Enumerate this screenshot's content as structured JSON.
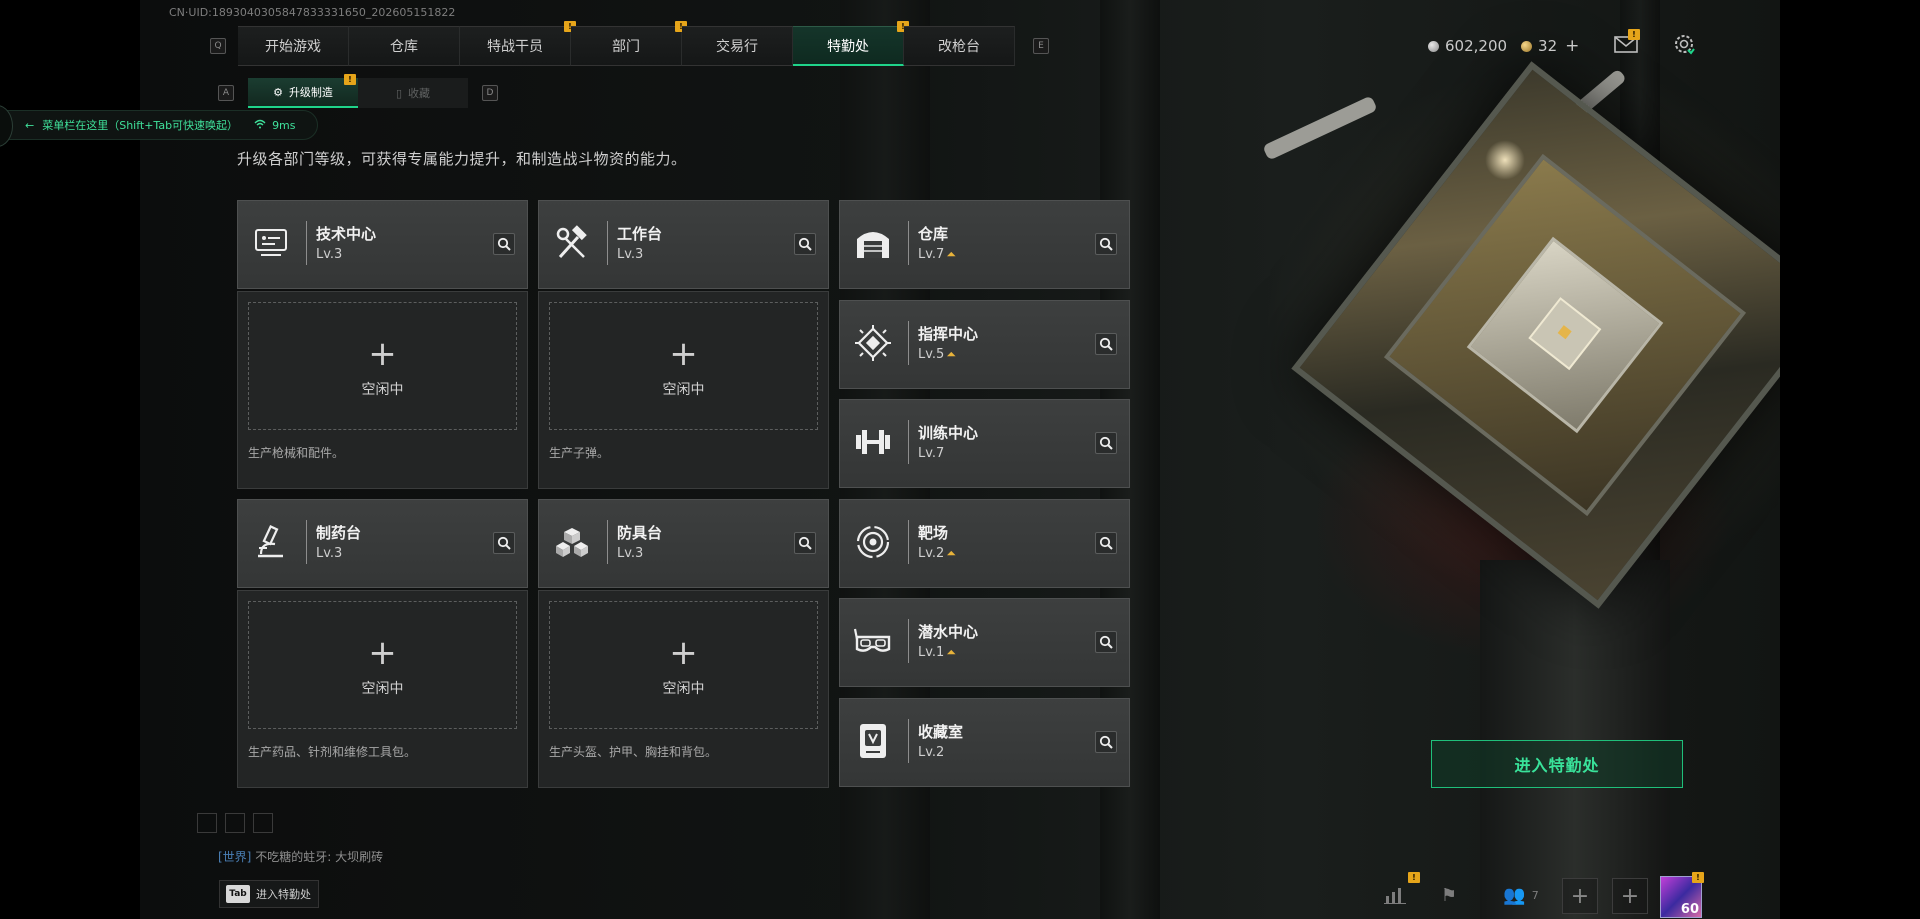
{
  "uid_text": "CN·UID:1893040305847833331650_202605151822",
  "nav": {
    "left_key": "Q",
    "right_key": "E",
    "tabs": [
      "开始游戏",
      "仓库",
      "特战干员",
      "部门",
      "交易行",
      "特勤处",
      "改枪台"
    ],
    "active_tab": "特勤处",
    "badges": [
      "特战干员",
      "部门",
      "特勤处"
    ],
    "badge_glyph": "!"
  },
  "resources": {
    "silver": "602,200",
    "gold": "32",
    "gold_add": "+"
  },
  "subnav": {
    "left_key": "A",
    "right_key": "D",
    "tabs": [
      "升级制造",
      "收藏"
    ],
    "active_tab": "升级制造"
  },
  "hint": {
    "text": "菜单栏在这里（Shift+Tab可快速唤起）",
    "ping": "9ms",
    "arrow": "←"
  },
  "description": "升级各部门等级，可获得专属能力提升，和制造战斗物资的能力。",
  "production": [
    {
      "name": "技术中心",
      "level": "Lv.3",
      "icon": "computer-icon",
      "slot_status": "空闲中",
      "slot_desc": "生产枪械和配件。"
    },
    {
      "name": "工作台",
      "level": "Lv.3",
      "icon": "tools-icon",
      "slot_status": "空闲中",
      "slot_desc": "生产子弹。"
    },
    {
      "name": "制药台",
      "level": "Lv.3",
      "icon": "microscope-icon",
      "slot_status": "空闲中",
      "slot_desc": "生产药品、针剂和维修工具包。"
    },
    {
      "name": "防具台",
      "level": "Lv.3",
      "icon": "armor-blocks-icon",
      "slot_status": "空闲中",
      "slot_desc": "生产头盔、护甲、胸挂和背包。"
    }
  ],
  "facilities": [
    {
      "name": "仓库",
      "level": "Lv.7",
      "upgradable": true,
      "icon": "warehouse-icon"
    },
    {
      "name": "指挥中心",
      "level": "Lv.5",
      "upgradable": true,
      "icon": "chip-icon"
    },
    {
      "name": "训练中心",
      "level": "Lv.7",
      "upgradable": false,
      "icon": "dumbbell-icon"
    },
    {
      "name": "靶场",
      "level": "Lv.2",
      "upgradable": true,
      "icon": "target-icon"
    },
    {
      "name": "潜水中心",
      "level": "Lv.1",
      "upgradable": true,
      "icon": "diving-mask-icon"
    },
    {
      "name": "收藏室",
      "level": "Lv.2",
      "upgradable": false,
      "icon": "trophy-icon"
    }
  ],
  "enter_button": "进入特勤处",
  "chat": {
    "channel": "[世界]",
    "user": "不吃糖的蛀牙:",
    "message": "大坝刷砖"
  },
  "tab_hint": {
    "key": "Tab",
    "label": "进入特勤处"
  },
  "bottom": {
    "friend_count": "7",
    "avatar_level": "60"
  },
  "colors": {
    "accent": "#1fd48a",
    "badge": "#e6a51a",
    "upgrade": "#e8b33a"
  }
}
